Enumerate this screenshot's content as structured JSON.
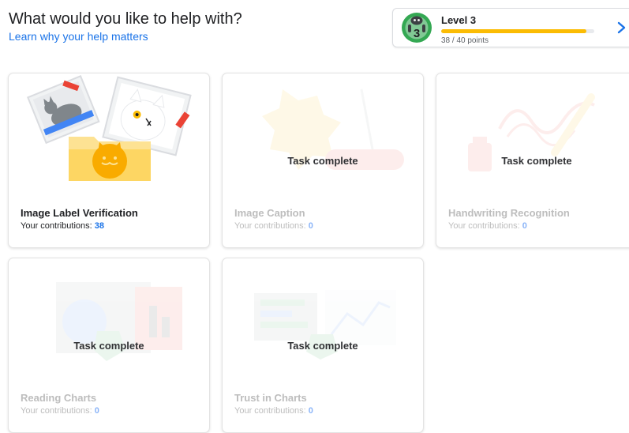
{
  "header": {
    "title": "What would you like to help with?",
    "link": "Learn why your help matters"
  },
  "level": {
    "title": "Level 3",
    "badge_number": "3",
    "points_text": "38 / 40 points",
    "progress": 0.95
  },
  "tasks": [
    {
      "name": "Image Label Verification",
      "contrib_label": "Your contributions: ",
      "count": "38",
      "complete": false
    },
    {
      "name": "Image Caption",
      "contrib_label": "Your contributions: ",
      "count": "0",
      "complete": true,
      "status": "Task complete"
    },
    {
      "name": "Handwriting Recognition",
      "contrib_label": "Your contributions: ",
      "count": "0",
      "complete": true,
      "status": "Task complete"
    },
    {
      "name": "Reading Charts",
      "contrib_label": "Your contributions: ",
      "count": "0",
      "complete": true,
      "status": "Task complete"
    },
    {
      "name": "Trust in Charts",
      "contrib_label": "Your contributions: ",
      "count": "0",
      "complete": true,
      "status": "Task complete"
    }
  ],
  "colors": {
    "accent": "#1a73e8",
    "progress": "#fbbc04",
    "badge": "#34a853"
  }
}
